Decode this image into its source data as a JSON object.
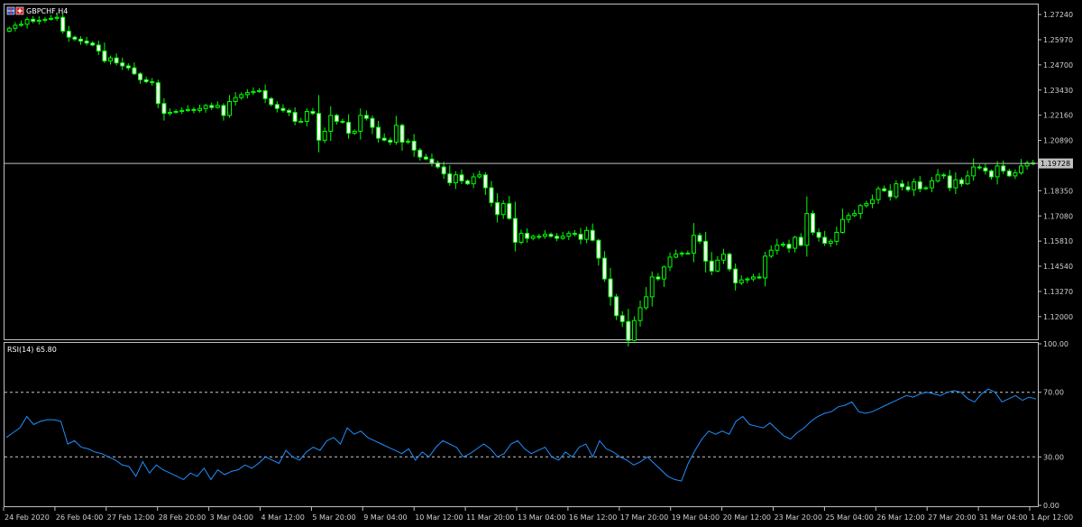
{
  "header": {
    "symbol": "GBPCHF,H4"
  },
  "indicator": {
    "label": "RSI(14) 65.80"
  },
  "current_price": {
    "label": "1.19728",
    "value": 1.19728
  },
  "colors": {
    "background": "#000000",
    "frame": "#c0c0c0",
    "candle": "#00ff00",
    "bull_fill": "#000000",
    "bear_fill": "#ffffff",
    "rsi_line": "#1e90ff",
    "levels": "#c8c8c8",
    "bid_line": "#c0c0c0",
    "price_label_bg": "#c0c0c0"
  },
  "chart_data": [
    {
      "type": "candlestick",
      "title": "GBPCHF,H4",
      "ylim": [
        1.109,
        1.277
      ],
      "yticks": [
        "1.27240",
        "1.25970",
        "1.24700",
        "1.23430",
        "1.22160",
        "1.20890",
        "1.19620",
        "1.18350",
        "1.17080",
        "1.15810",
        "1.14540",
        "1.13270",
        "1.12000"
      ],
      "x_labels": [
        "24 Feb 2020",
        "26 Feb 04:00",
        "27 Feb 12:00",
        "28 Feb 20:00",
        "3 Mar 04:00",
        "4 Mar 12:00",
        "5 Mar 20:00",
        "9 Mar 04:00",
        "10 Mar 12:00",
        "11 Mar 20:00",
        "13 Mar 04:00",
        "16 Mar 12:00",
        "17 Mar 20:00",
        "19 Mar 04:00",
        "20 Mar 12:00",
        "23 Mar 20:00",
        "25 Mar 04:00",
        "26 Mar 12:00",
        "27 Mar 20:00",
        "31 Mar 04:00",
        "1 Apr 12:00"
      ],
      "close": [
        1.2655,
        1.267,
        1.2675,
        1.27,
        1.269,
        1.2695,
        1.27,
        1.2705,
        1.271,
        1.264,
        1.261,
        1.26,
        1.259,
        1.258,
        1.257,
        1.254,
        1.249,
        1.2505,
        1.248,
        1.2465,
        1.2455,
        1.2425,
        1.2395,
        1.2385,
        1.238,
        1.2275,
        1.2225,
        1.223,
        1.2235,
        1.224,
        1.2245,
        1.224,
        1.225,
        1.2265,
        1.2255,
        1.2265,
        1.2215,
        1.2285,
        1.2305,
        1.232,
        1.233,
        1.2335,
        1.234,
        1.23,
        1.227,
        1.225,
        1.224,
        1.223,
        1.2185,
        1.2185,
        1.2235,
        1.2225,
        1.209,
        1.2135,
        1.2215,
        1.2185,
        1.218,
        1.2125,
        1.2135,
        1.2215,
        1.22,
        1.2155,
        1.21,
        1.209,
        1.208,
        1.2165,
        1.208,
        1.2085,
        1.204,
        1.2005,
        1.1995,
        1.1975,
        1.1955,
        1.192,
        1.1875,
        1.1915,
        1.1885,
        1.187,
        1.1905,
        1.1915,
        1.185,
        1.1775,
        1.1715,
        1.177,
        1.1695,
        1.1575,
        1.162,
        1.1595,
        1.1605,
        1.1605,
        1.1615,
        1.1605,
        1.1595,
        1.1605,
        1.162,
        1.1615,
        1.159,
        1.1635,
        1.1585,
        1.1495,
        1.139,
        1.13,
        1.1205,
        1.1175,
        1.108,
        1.118,
        1.1245,
        1.13,
        1.14,
        1.139,
        1.145,
        1.15,
        1.1515,
        1.152,
        1.152,
        1.161,
        1.158,
        1.148,
        1.143,
        1.1485,
        1.1515,
        1.144,
        1.137,
        1.1385,
        1.139,
        1.14,
        1.1395,
        1.1505,
        1.1535,
        1.156,
        1.1565,
        1.1545,
        1.16,
        1.156,
        1.172,
        1.1625,
        1.16,
        1.157,
        1.158,
        1.1625,
        1.169,
        1.171,
        1.172,
        1.176,
        1.177,
        1.179,
        1.1845,
        1.1835,
        1.1805,
        1.187,
        1.1855,
        1.184,
        1.188,
        1.1845,
        1.185,
        1.1885,
        1.1915,
        1.191,
        1.185,
        1.189,
        1.187,
        1.191,
        1.1955,
        1.195,
        1.1935,
        1.1905,
        1.196,
        1.1935,
        1.191,
        1.1925,
        1.196,
        1.1975,
        1.1973
      ]
    },
    {
      "type": "line",
      "title": "RSI(14) 65.80",
      "ylim": [
        0,
        100
      ],
      "yticks": [
        "100.00",
        "70.00",
        "30.00",
        "0.00"
      ],
      "levels": [
        70,
        30
      ],
      "series": [
        {
          "values": [
            42,
            45,
            48,
            55,
            50,
            52,
            53,
            53,
            52,
            38,
            40,
            36,
            35,
            33,
            32,
            30,
            28,
            25,
            24,
            18,
            27,
            20,
            25,
            22,
            20,
            18,
            16,
            20,
            18,
            23,
            16,
            22,
            19,
            21,
            22,
            25,
            23,
            26,
            30,
            28,
            26,
            34,
            30,
            28,
            33,
            36,
            34,
            40,
            42,
            38,
            48,
            44,
            46,
            42,
            40,
            38,
            36,
            34,
            32,
            35,
            28,
            33,
            30,
            36,
            40,
            38,
            36,
            30,
            32,
            35,
            38,
            35,
            30,
            32,
            38,
            40,
            35,
            32,
            34,
            36,
            30,
            28,
            33,
            30,
            36,
            38,
            30,
            40,
            35,
            33,
            30,
            28,
            25,
            27,
            30,
            26,
            22,
            18,
            16,
            15,
            26,
            34,
            41,
            46,
            44,
            46,
            44,
            52,
            55,
            50,
            49,
            48,
            51,
            47,
            43,
            41,
            45,
            48,
            52,
            55,
            57,
            58,
            61,
            62,
            64,
            58,
            57,
            58,
            60,
            62,
            64,
            66,
            68,
            67,
            69,
            70,
            69,
            68,
            70,
            71,
            70,
            66,
            64,
            69,
            72,
            70,
            64,
            66,
            68,
            65,
            67,
            65.8
          ]
        }
      ]
    }
  ]
}
